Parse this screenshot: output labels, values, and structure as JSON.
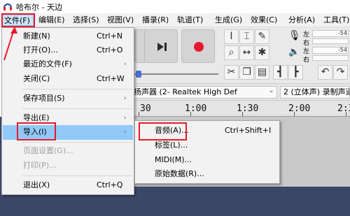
{
  "window": {
    "title": "哈布尔 - 天边",
    "app_icon": "headphones-icon"
  },
  "menubar": {
    "items": [
      {
        "label": "文件(F)"
      },
      {
        "label": "编辑(E)"
      },
      {
        "label": "选择(S)"
      },
      {
        "label": "视图(V)"
      },
      {
        "label": "播录(R)"
      },
      {
        "label": "轨道(T)"
      },
      {
        "label": "生成(G)"
      },
      {
        "label": "效果(C)"
      },
      {
        "label": "分析(A)"
      },
      {
        "label": "工具(T)"
      }
    ]
  },
  "file_menu": {
    "items": [
      {
        "label": "新建(N)",
        "shortcut": "Ctrl+N"
      },
      {
        "label": "打开(O)...",
        "shortcut": "Ctrl+O"
      },
      {
        "label": "最近的文件(F)",
        "submenu": true
      },
      {
        "label": "关闭(C)",
        "shortcut": "Ctrl+W"
      },
      {
        "label": "保存项目(S)",
        "submenu": true
      },
      {
        "label": "导出(E)",
        "submenu": true
      },
      {
        "label": "导入(I)",
        "submenu": true,
        "highlighted": true
      },
      {
        "label": "页面设置(G)...",
        "disabled": true
      },
      {
        "label": "打印(P)...",
        "disabled": true
      },
      {
        "label": "退出(X)",
        "shortcut": "Ctrl+Q"
      }
    ],
    "arrow_glyph": "›"
  },
  "import_menu": {
    "items": [
      {
        "label": "音频(A)...",
        "shortcut": "Ctrl+Shift+I"
      },
      {
        "label": "标签(L)..."
      },
      {
        "label": "MIDI(M)..."
      },
      {
        "label": "原始数据(R)..."
      }
    ]
  },
  "meters": {
    "left_label": "左",
    "right_label": "右",
    "value_a": "-54",
    "value_b": "-54"
  },
  "devices": {
    "output_device": "扬声器 (2- Realtek High Def",
    "channels": "2 (立体声) 录制声道"
  },
  "timeline": {
    "ticks": [
      "30",
      "1:00",
      "1:30",
      "2:00",
      "2:3"
    ]
  },
  "colors": {
    "highlight": "#91c9f7",
    "annotation": "#e8192c",
    "track_bg": "#3c4768",
    "record": "#e8192c"
  }
}
